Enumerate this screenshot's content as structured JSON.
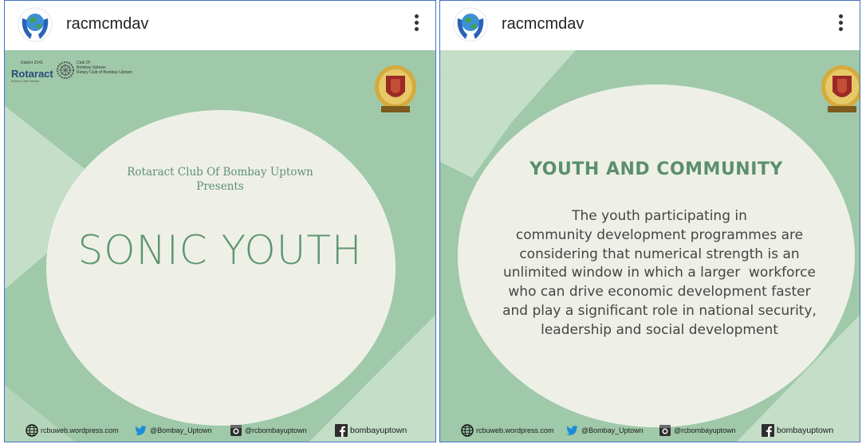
{
  "posts": [
    {
      "username": "racmcmdav",
      "logo": {
        "district": "District 3141",
        "name": "Rotaract",
        "sub": "Rotary Club Partner",
        "club_line1": "Club Of",
        "club_line2": "Bombay Uptown",
        "club_line3": "Rotary Club of Bombay Uptown"
      },
      "presenter_line1": "Rotaract Club Of Bombay Uptown",
      "presenter_line2": "Presents",
      "title": "SONIC YOUTH",
      "footer": {
        "web": "rcbuweb.wordpress.com",
        "twitter": "@Bombay_Uptown",
        "instagram": "@rcbombayuptown",
        "facebook": "bombayuptown"
      }
    },
    {
      "username": "racmcmdav",
      "heading": "YOUTH AND COMMUNITY",
      "body": [
        "The youth participating in",
        "community development programmes are",
        "considering that numerical strength is an",
        "unlimited window in which a larger  workforce",
        "who can drive economic development faster",
        "and play a significant role in national security,",
        "leadership and social development"
      ],
      "footer": {
        "web": "rcbuweb.wordpress.com",
        "twitter": "@Bombay_Uptown",
        "instagram": "@rcbombayuptown",
        "facebook": "bombayuptown"
      }
    }
  ],
  "colors": {
    "background_green": "#9fc9a8",
    "light_stripe": "#c4dec8",
    "circle": "#eef0e8",
    "title_green": "#5d9670",
    "panel_border": "#4472c4"
  },
  "icons": [
    "globe-hands-avatar-icon",
    "more-vertical-icon",
    "globe-icon",
    "twitter-icon",
    "instagram-icon",
    "facebook-icon",
    "crest-emblem-icon",
    "rotary-wheel-icon"
  ]
}
